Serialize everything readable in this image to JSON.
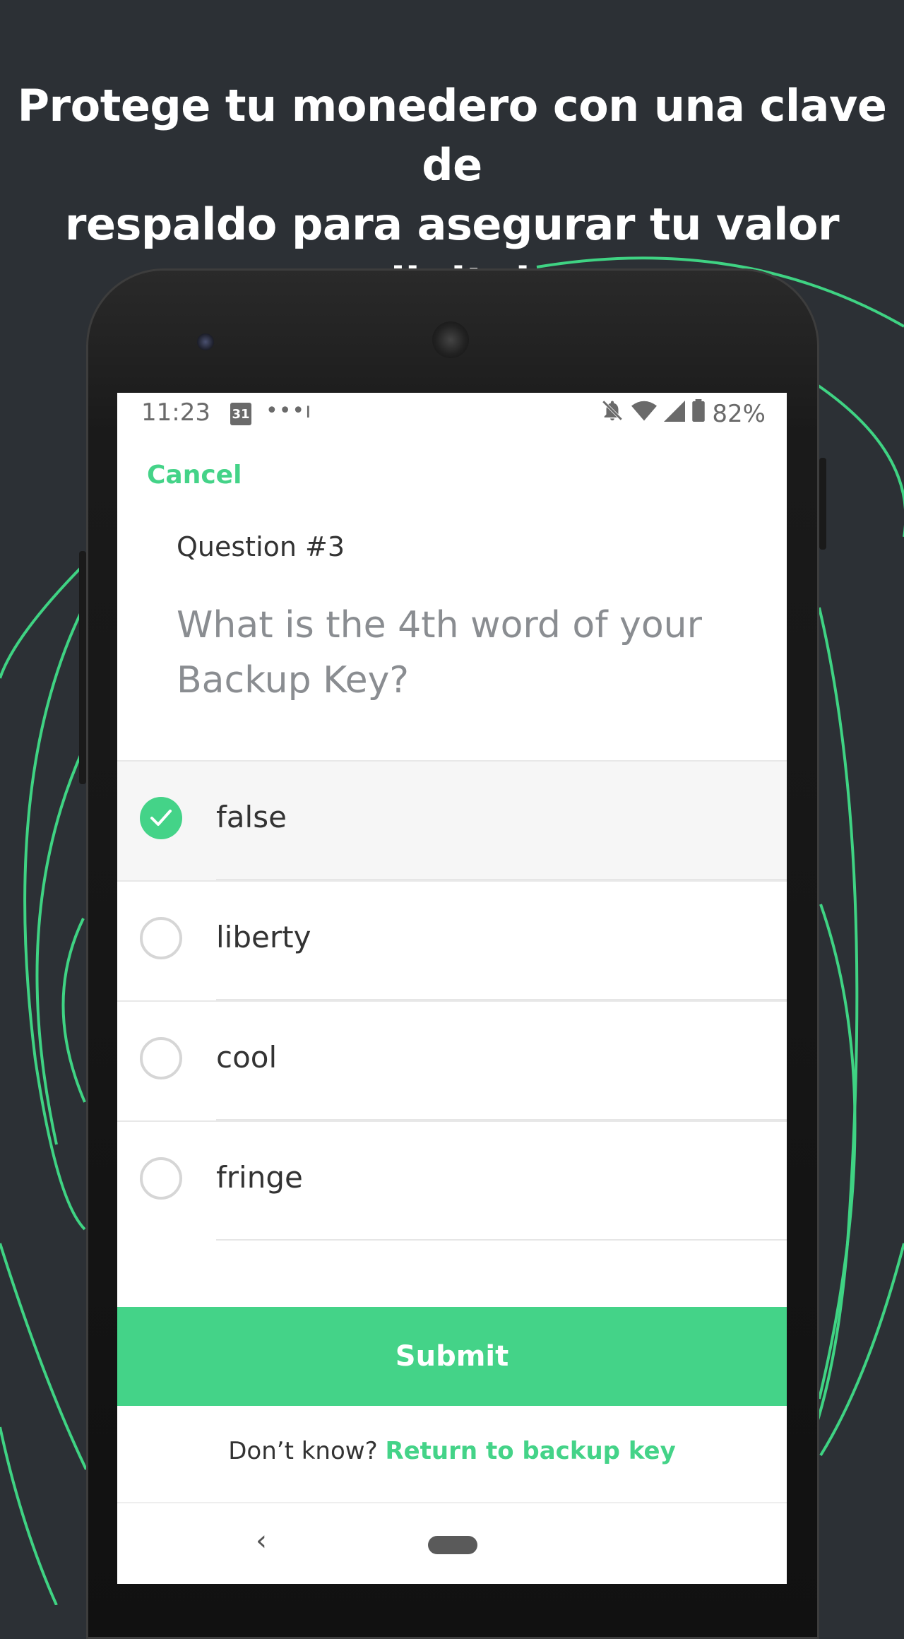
{
  "headline": {
    "line1": "Protege tu monedero con una clave de",
    "line2": "respaldo para asegurar tu valor digital"
  },
  "status_bar": {
    "time": "11:23",
    "calendar_day": "31",
    "battery": "82%"
  },
  "header": {
    "cancel_label": "Cancel"
  },
  "question": {
    "label": "Question #3",
    "text": "What is the 4th word of your Backup Key?"
  },
  "options": [
    {
      "label": "false",
      "selected": true
    },
    {
      "label": "liberty",
      "selected": false
    },
    {
      "label": "cool",
      "selected": false
    },
    {
      "label": "fringe",
      "selected": false
    }
  ],
  "submit_label": "Submit",
  "footer": {
    "prompt": "Don’t know?",
    "link": "Return to backup key"
  },
  "colors": {
    "background": "#2c3035",
    "accent": "#44d388",
    "arc": "#3fd383"
  },
  "icons": [
    "calendar-icon",
    "dots-icon",
    "bell-off-icon",
    "wifi-icon",
    "signal-icon",
    "battery-icon",
    "check-icon",
    "back-icon",
    "home-icon"
  ]
}
